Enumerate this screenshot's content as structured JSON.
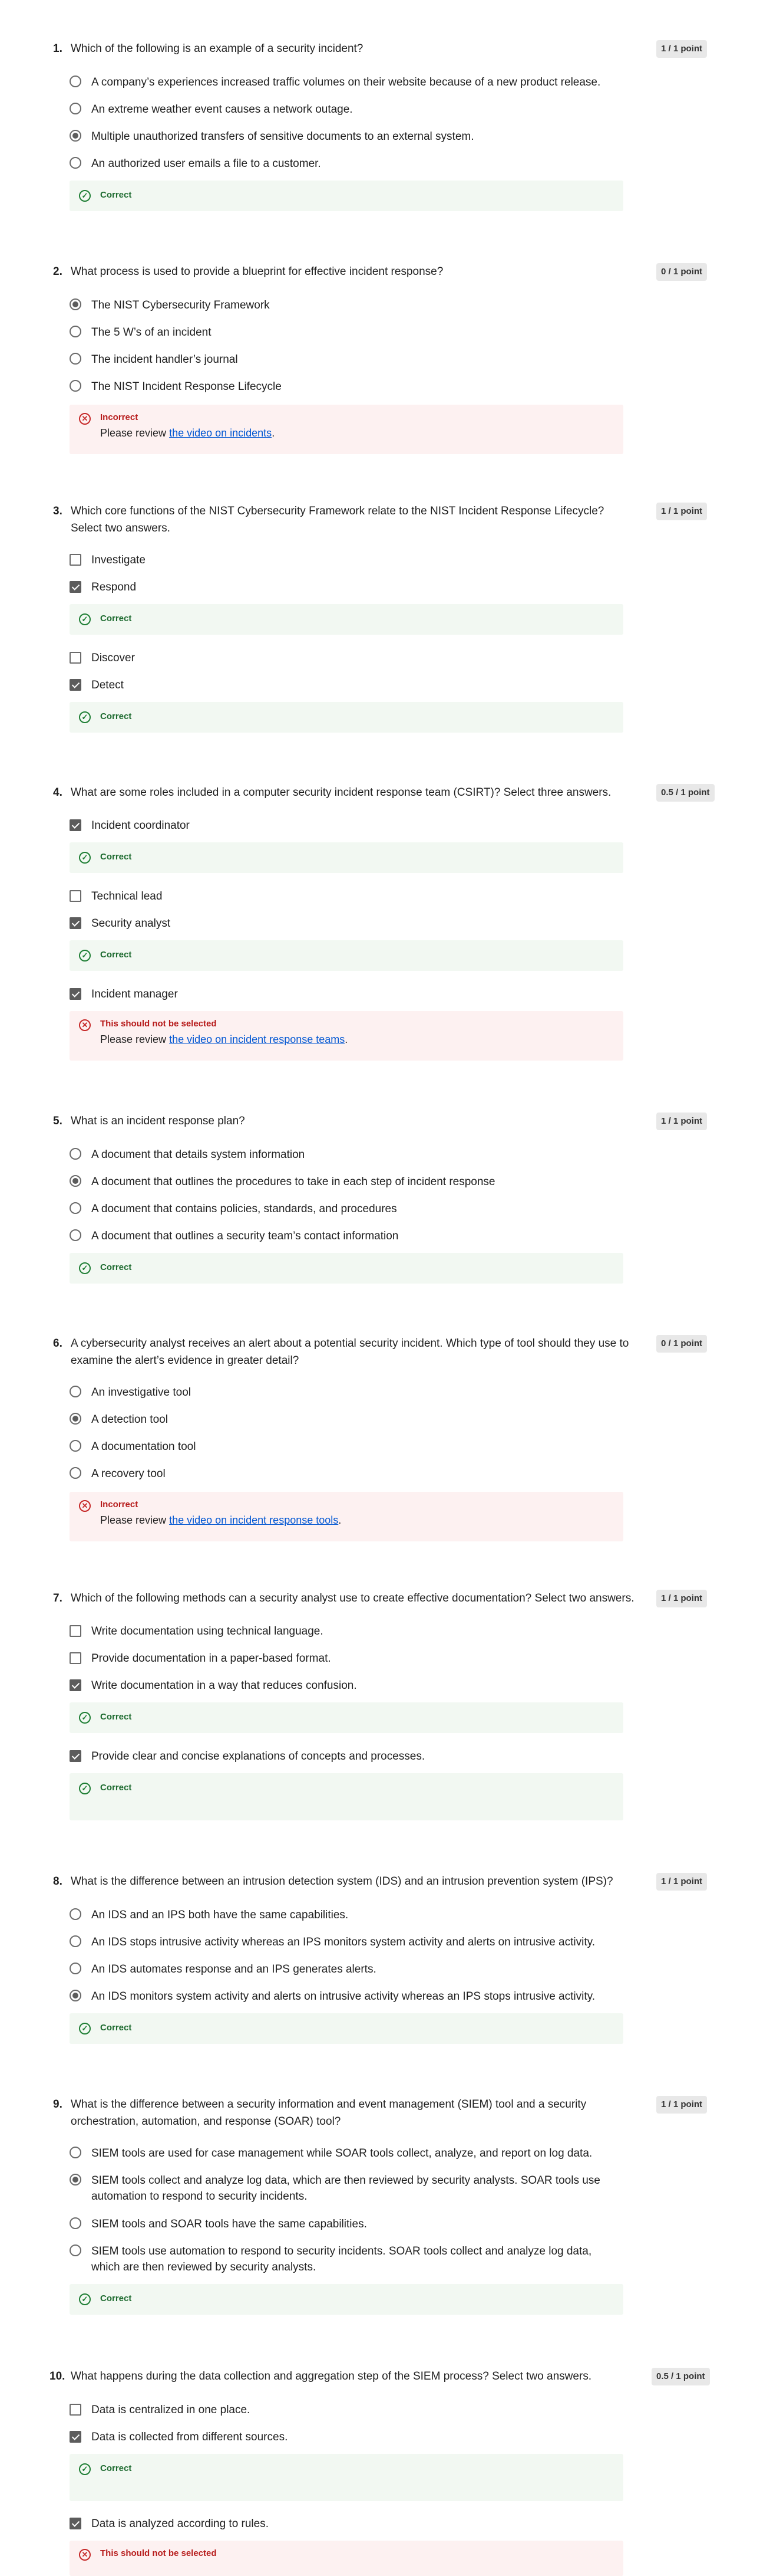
{
  "colors": {
    "correct": "#1e7e34",
    "incorrect": "#c62828",
    "link": "#0056d2",
    "points_bg": "#e8e8e8"
  },
  "feedback_labels": {
    "correct": "Correct",
    "incorrect": "Incorrect",
    "not_selected": "This should not be selected",
    "review_prefix": "Please review "
  },
  "questions": [
    {
      "number": "1.",
      "text": "Which of the following is an example of a security incident?",
      "points": "1 / 1 point",
      "options": [
        "A company’s experiences increased traffic volumes on their website because of a new product release.",
        "An extreme weather event causes a network outage.",
        "Multiple unauthorized transfers of sensitive documents to an external system.",
        "An authorized user emails a file to a customer."
      ]
    },
    {
      "number": "2.",
      "text": "What process is used to provide a blueprint for effective incident response?",
      "points": "0 / 1 point",
      "options": [
        "The NIST Cybersecurity Framework",
        "The 5 W’s of an incident",
        "The incident handler’s journal",
        "The NIST Incident Response Lifecycle"
      ],
      "link": "the video on incidents"
    },
    {
      "number": "3.",
      "text": "Which core functions of the NIST Cybersecurity Framework relate to the NIST Incident Response Lifecycle? Select two answers.",
      "points": "1 / 1 point",
      "options": [
        "Investigate",
        "Respond",
        "Discover",
        "Detect"
      ]
    },
    {
      "number": "4.",
      "text": "What are some roles included in a computer security incident response team (CSIRT)? Select three answers.",
      "points": "0.5 / 1 point",
      "options": [
        "Incident coordinator",
        "Technical lead",
        "Security analyst",
        "Incident manager"
      ],
      "link": "the video on incident response teams"
    },
    {
      "number": "5.",
      "text": "What is an incident response plan?",
      "points": "1 / 1 point",
      "options": [
        "A document that details system information",
        "A document that outlines the procedures to take in each step of incident response",
        "A document that contains policies, standards, and procedures",
        "A document that outlines a security team’s contact information"
      ]
    },
    {
      "number": "6.",
      "text": "A cybersecurity analyst receives an alert about a potential security incident. Which type of tool should they use to examine the alert’s evidence in greater detail?",
      "points": "0 / 1 point",
      "options": [
        "An investigative tool",
        "A detection tool",
        "A documentation tool",
        "A recovery tool"
      ],
      "link": "the video on incident response tools"
    },
    {
      "number": "7.",
      "text": "Which of the following methods can a security analyst use to create effective documentation? Select two answers.",
      "points": "1 / 1 point",
      "options": [
        "Write documentation using technical language.",
        "Provide documentation in a paper-based format.",
        "Write documentation in a way that reduces confusion.",
        "Provide clear and concise explanations of concepts and processes."
      ]
    },
    {
      "number": "8.",
      "text": "What is the difference between an intrusion detection system (IDS) and an intrusion prevention system (IPS)?",
      "points": "1 / 1 point",
      "options": [
        "An IDS and an IPS both have the same capabilities.",
        "An IDS stops intrusive activity whereas an IPS monitors system activity and alerts on intrusive activity.",
        "An IDS automates response and an IPS generates alerts.",
        "An IDS monitors system activity and alerts on intrusive activity whereas an IPS stops intrusive activity."
      ]
    },
    {
      "number": "9.",
      "text": "What is the difference between a security information and event management (SIEM) tool and a security orchestration, automation, and response (SOAR) tool?",
      "points": "1 / 1 point",
      "options": [
        "SIEM tools are used for case management while SOAR tools collect, analyze, and report on log data.",
        "SIEM tools collect and analyze log data, which are then reviewed by security analysts. SOAR tools use automation to respond to security incidents.",
        "SIEM tools and SOAR tools have the same capabilities.",
        "SIEM tools use automation to respond to security incidents. SOAR tools collect and analyze log data, which are then reviewed by security analysts."
      ]
    },
    {
      "number": "10.",
      "text": "What happens during the data collection and aggregation step of the SIEM process? Select two answers.",
      "points": "0.5 / 1 point",
      "options": [
        "Data is centralized in one place.",
        "Data is collected from different sources.",
        "Data is analyzed according to rules."
      ]
    }
  ]
}
